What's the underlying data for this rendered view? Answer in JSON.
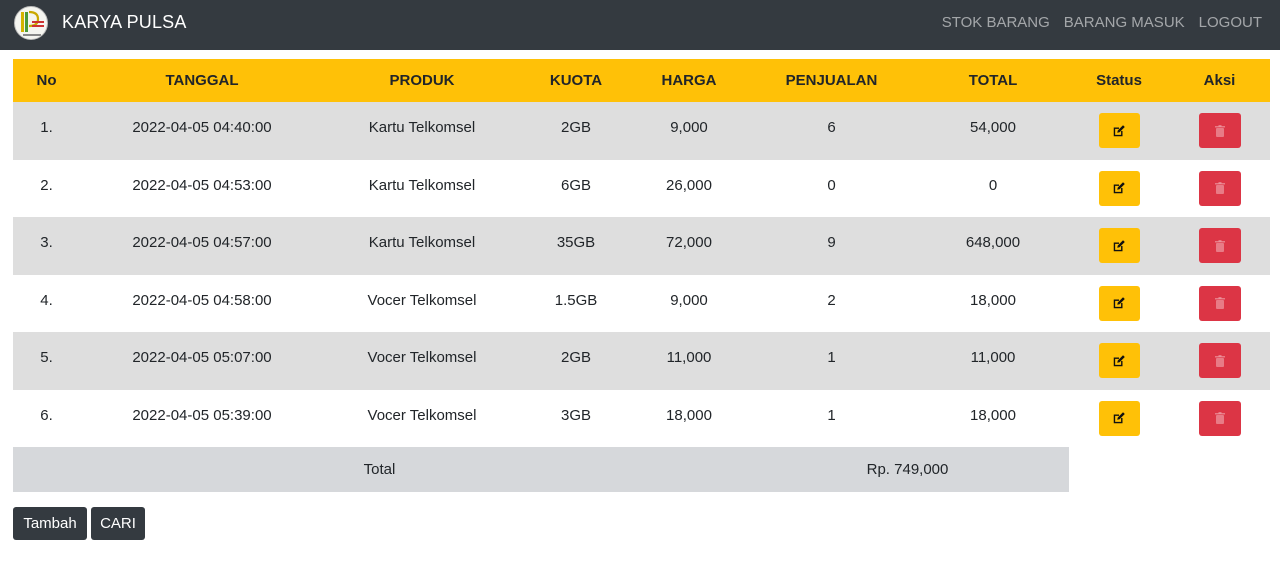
{
  "navbar": {
    "brand": "KARYA PULSA",
    "logo_icon": "store-logo-icon",
    "links": [
      "STOK BARANG",
      "BARANG MASUK",
      "LOGOUT"
    ]
  },
  "table": {
    "headers": {
      "no": "No",
      "tanggal": "TANGGAL",
      "produk": "PRODUK",
      "kuota": "KUOTA",
      "harga": "HARGA",
      "penjualan": "PENJUALAN",
      "total": "TOTAL",
      "status": "Status",
      "aksi": "Aksi"
    },
    "rows": [
      {
        "no": "1.",
        "tanggal": "2022-04-05 04:40:00",
        "produk": "Kartu Telkomsel",
        "kuota": "2GB",
        "harga": "9,000",
        "penjualan": "6",
        "total": "54,000"
      },
      {
        "no": "2.",
        "tanggal": "2022-04-05 04:53:00",
        "produk": "Kartu Telkomsel",
        "kuota": "6GB",
        "harga": "26,000",
        "penjualan": "0",
        "total": "0"
      },
      {
        "no": "3.",
        "tanggal": "2022-04-05 04:57:00",
        "produk": "Kartu Telkomsel",
        "kuota": "35GB",
        "harga": "72,000",
        "penjualan": "9",
        "total": "648,000"
      },
      {
        "no": "4.",
        "tanggal": "2022-04-05 04:58:00",
        "produk": "Vocer Telkomsel",
        "kuota": "1.5GB",
        "harga": "9,000",
        "penjualan": "2",
        "total": "18,000"
      },
      {
        "no": "5.",
        "tanggal": "2022-04-05 05:07:00",
        "produk": "Vocer Telkomsel",
        "kuota": "2GB",
        "harga": "11,000",
        "penjualan": "1",
        "total": "11,000"
      },
      {
        "no": "6.",
        "tanggal": "2022-04-05 05:39:00",
        "produk": "Vocer Telkomsel",
        "kuota": "3GB",
        "harga": "18,000",
        "penjualan": "1",
        "total": "18,000"
      }
    ],
    "total_label": "Total",
    "total_value": "Rp. 749,000"
  },
  "buttons": {
    "tambah": "Tambah",
    "cari": "CARI"
  },
  "icons": {
    "edit": "edit-icon",
    "delete": "trash-icon"
  },
  "colors": {
    "navbar": "#343a40",
    "header": "#ffc107",
    "edit_button": "#ffc107",
    "delete_button": "#dc3545",
    "striped_row": "#dedede",
    "total_row": "#d6d8db"
  }
}
